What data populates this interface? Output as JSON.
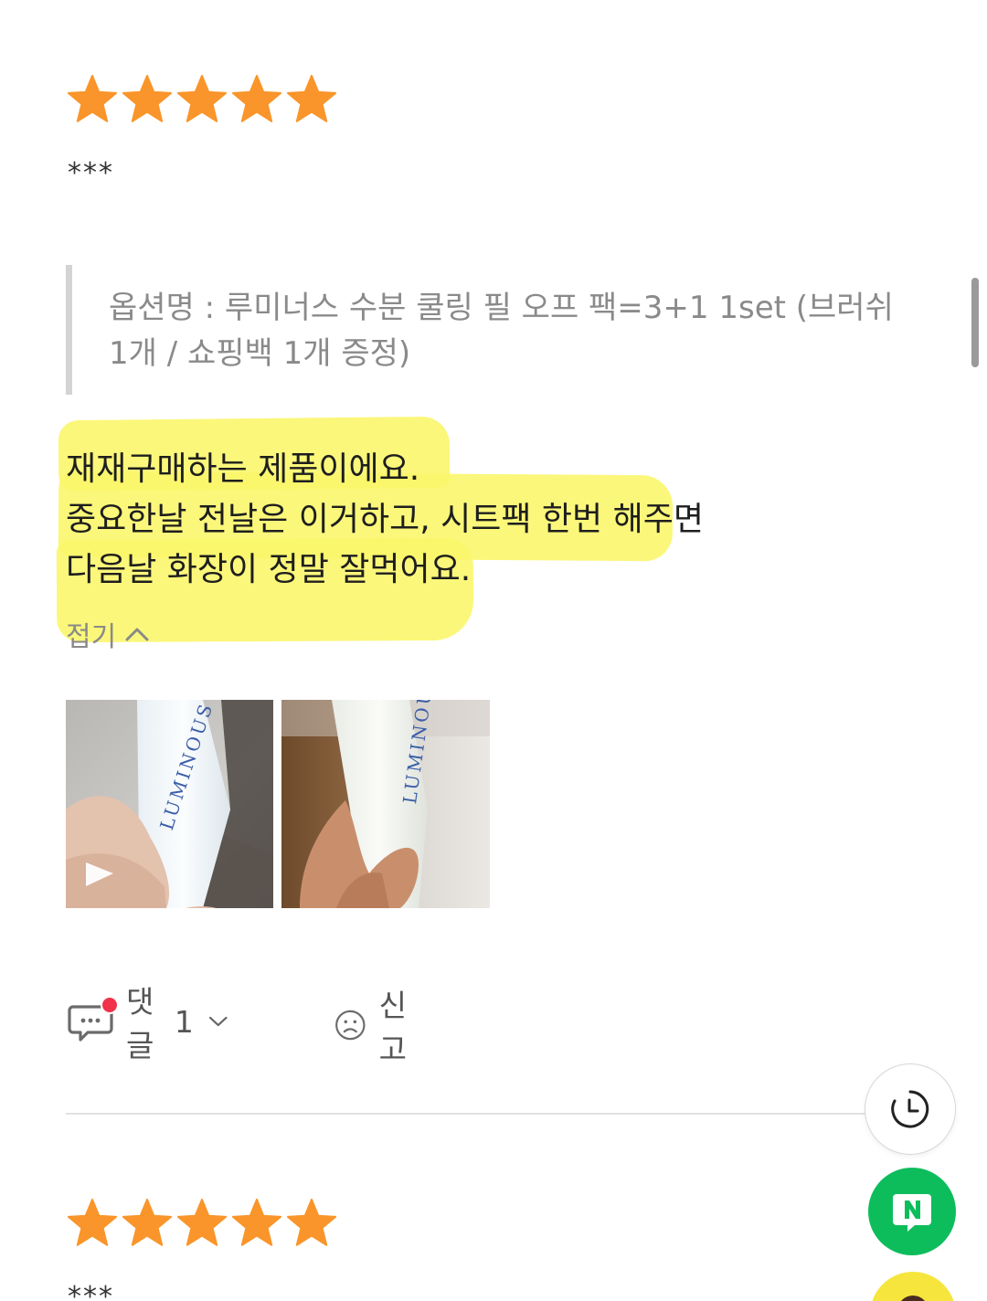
{
  "colors": {
    "star": "#f9952a",
    "highlight": "#fbf66b",
    "notification_dot": "#f0334a",
    "naver_green": "#0dbd5c",
    "brand_blue": "#3a5ea8"
  },
  "reviews": [
    {
      "rating": 5,
      "max_rating": 5,
      "author": "***",
      "option_text": "옵션명 : 루미너스 수분 쿨링 필 오프 팩=3+1 1set (브러쉬 1개 / 쇼핑백 1개 증정)",
      "body_lines": [
        "재재구매하는 제품이에요.",
        "중요한날 전날은 이거하고, 시트팩 한번 해주면",
        "다음날 화장이 정말 잘먹어요."
      ],
      "fold_label": "접기",
      "photos": [
        {
          "brand": "LUMINOUS",
          "is_video": true
        },
        {
          "brand": "LUMINOUS",
          "is_video": false
        }
      ],
      "comment_label": "댓글",
      "comment_count": "1",
      "report_label": "신고"
    },
    {
      "rating": 5,
      "max_rating": 5,
      "author": "***"
    }
  ],
  "icons": {
    "star": "star-icon",
    "fold": "chevron-up-icon",
    "play": "play-icon",
    "comment": "chat-bubble-icon",
    "expand": "chevron-down-icon",
    "report": "sad-face-icon",
    "history": "clock-icon",
    "naver": "naver-talk-icon"
  }
}
